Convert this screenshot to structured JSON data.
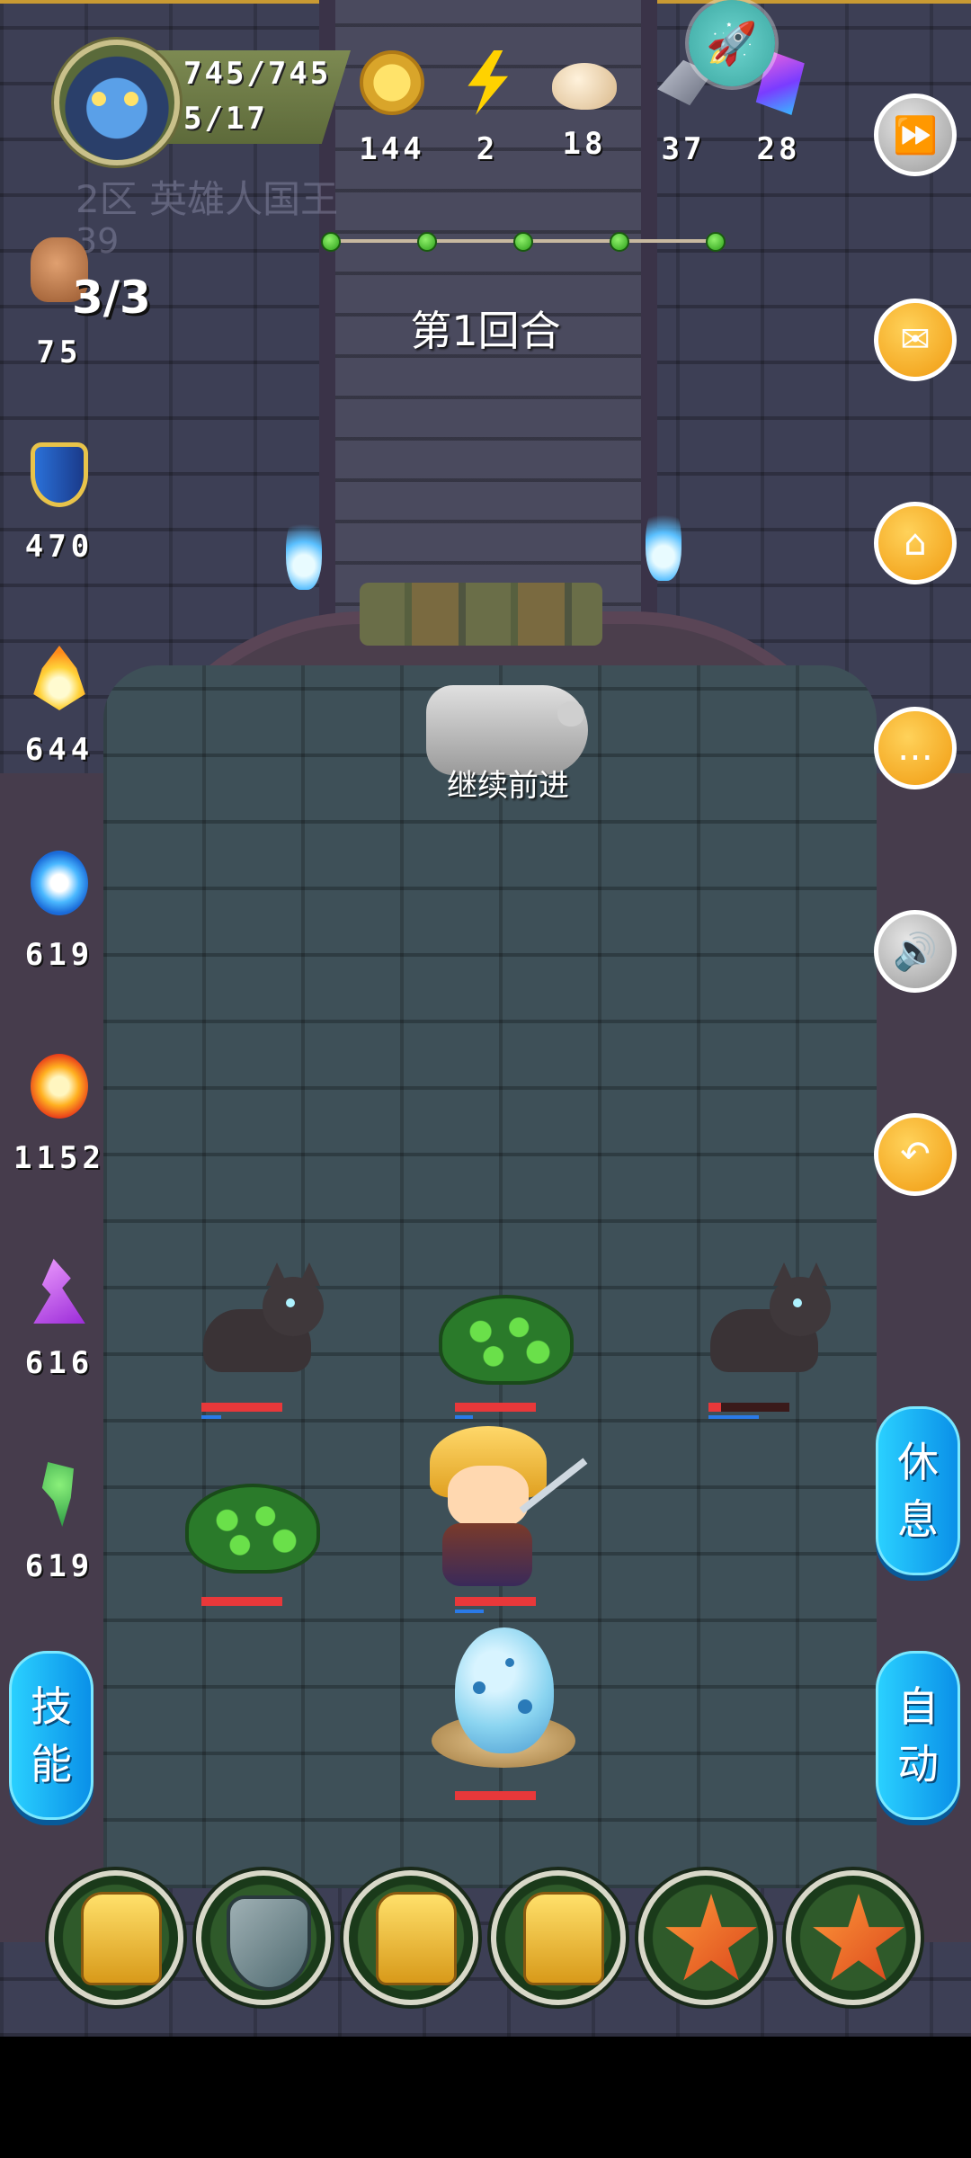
{
  "player": {
    "hp": "745/745",
    "level": "5/17",
    "ghost_name": "2区 英雄人国王",
    "ghost_number": "39"
  },
  "currencies": [
    {
      "icon": "gold-coin-icon",
      "value": "144"
    },
    {
      "icon": "lightning-icon",
      "value": "2"
    },
    {
      "icon": "bun-icon",
      "value": "18"
    },
    {
      "icon": "iron-ingot-icon",
      "value": "37"
    },
    {
      "icon": "crystal-icon",
      "value": "28"
    }
  ],
  "wave": {
    "dots": 5,
    "round_label": "第1回合"
  },
  "stats": {
    "fist_ratio": "3/3",
    "attack": "75",
    "defense": "470",
    "holy": "644",
    "water": "619",
    "fire": "1152",
    "lightning": "616",
    "poison": "619"
  },
  "guide": {
    "label": "继续前进"
  },
  "buttons": {
    "rest": [
      "休",
      "息"
    ],
    "auto": [
      "自",
      "动"
    ],
    "skills": [
      "技",
      "能"
    ]
  },
  "units": {
    "cat_left": {
      "hp": 1.0
    },
    "boar_top": {
      "hp": 1.0
    },
    "cat_right": {
      "hp": 0.15
    },
    "boar_left": {
      "hp": 1.0
    },
    "hero": {
      "hp": 1.0
    },
    "egg": {
      "hp": 1.0
    }
  },
  "dock": [
    "claw-skill-icon",
    "horned-shield-skill-icon",
    "claw-skill-icon",
    "claw-skill-icon",
    "star-skill-icon",
    "star-skill-icon"
  ],
  "colors": {
    "accent": "#f09a10",
    "pill": "#0a90e8",
    "hp": "#e8383a"
  }
}
